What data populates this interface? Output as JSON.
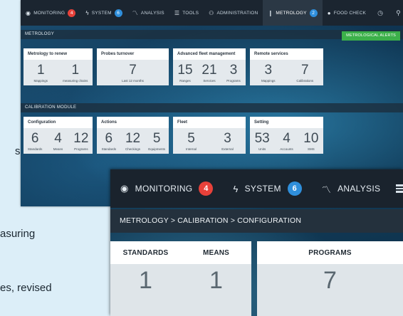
{
  "page_fragments": {
    "line1": "s",
    "line2": "asuring",
    "line3": "es, revised"
  },
  "back_screen": {
    "nav": {
      "monitoring": "MONITORING",
      "monitoring_badge": "4",
      "system": "SYSTEM",
      "system_badge": "6",
      "analysis": "ANALYSIS",
      "tools": "TOOLS",
      "administration": "ADMINISTRATION",
      "metrology": "METROLOGY",
      "metrology_badge": "2",
      "food_check": "FOOD CHECK"
    },
    "section_metrology": "METROLOGY",
    "alerts_button": "METROLOGICAL ALERTS",
    "cards_top": [
      {
        "title": "Metrology to renew",
        "items": [
          {
            "value": "1",
            "label": "Mappings"
          },
          {
            "value": "1",
            "label": "measuring chains"
          }
        ]
      },
      {
        "title": "Probes turnover",
        "items": [
          {
            "value": "7",
            "label": "Last 12 months"
          }
        ]
      },
      {
        "title": "Advanced fleet management",
        "items": [
          {
            "value": "15",
            "label": "Ranges"
          },
          {
            "value": "21",
            "label": "Services"
          },
          {
            "value": "3",
            "label": "Programs"
          }
        ]
      },
      {
        "title": "Remote services",
        "items": [
          {
            "value": "3",
            "label": "Mappings"
          },
          {
            "value": "7",
            "label": "Calibrations"
          }
        ]
      }
    ],
    "section_calibration": "CALIBRATION MODULE",
    "cards_bottom": [
      {
        "title": "Configuration",
        "items": [
          {
            "value": "6",
            "label": "Standards"
          },
          {
            "value": "4",
            "label": "Means"
          },
          {
            "value": "12",
            "label": "Programs"
          }
        ]
      },
      {
        "title": "Actions",
        "items": [
          {
            "value": "6",
            "label": "Standards"
          },
          {
            "value": "12",
            "label": "Checkings"
          },
          {
            "value": "5",
            "label": "Equipments"
          }
        ]
      },
      {
        "title": "Fleet",
        "items": [
          {
            "value": "5",
            "label": "Internal"
          },
          {
            "value": "3",
            "label": "External"
          }
        ]
      },
      {
        "title": "Setting",
        "items": [
          {
            "value": "53",
            "label": "Units"
          },
          {
            "value": "4",
            "label": "Accounts"
          },
          {
            "value": "10",
            "label": "SMS"
          }
        ]
      }
    ]
  },
  "front_screen": {
    "nav": {
      "monitoring": "MONITORING",
      "monitoring_badge": "4",
      "system": "SYSTEM",
      "system_badge": "6",
      "analysis": "ANALYSIS"
    },
    "breadcrumb": "METROLOGY > CALIBRATION > CONFIGURATION",
    "card_left": {
      "labels": [
        "STANDARDS",
        "MEANS"
      ],
      "values": [
        "1",
        "1"
      ]
    },
    "card_right": {
      "label": "PROGRAMS",
      "value": "7"
    }
  },
  "colors": {
    "nav_bg": "#1b2530",
    "badge_red": "#e8413a",
    "badge_blue": "#2f8fdc",
    "alert_green": "#3cb04a"
  }
}
